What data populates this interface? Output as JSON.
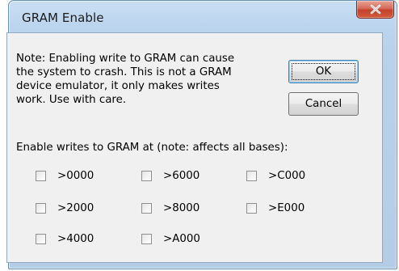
{
  "window": {
    "title": "GRAM Enable"
  },
  "note_lines": [
    "Note: Enabling write to GRAM can cause",
    "the system to crash. This is not a GRAM",
    "device emulator, it only makes writes",
    "work. Use with care."
  ],
  "buttons": {
    "ok_label": "OK",
    "cancel_label": "Cancel"
  },
  "section_label": "Enable writes to GRAM at (note: affects all bases):",
  "checkboxes": [
    {
      "label": ">0000",
      "checked": false
    },
    {
      "label": ">6000",
      "checked": false
    },
    {
      "label": ">C000",
      "checked": false
    },
    {
      "label": ">2000",
      "checked": false
    },
    {
      "label": ">8000",
      "checked": false
    },
    {
      "label": ">E000",
      "checked": false
    },
    {
      "label": ">4000",
      "checked": false
    },
    {
      "label": ">A000",
      "checked": false
    }
  ],
  "icons": {
    "close": "close-icon"
  },
  "colors": {
    "frame": "#b9d1ea",
    "client": "#f0f0f0",
    "close_button": "#c4402b"
  }
}
